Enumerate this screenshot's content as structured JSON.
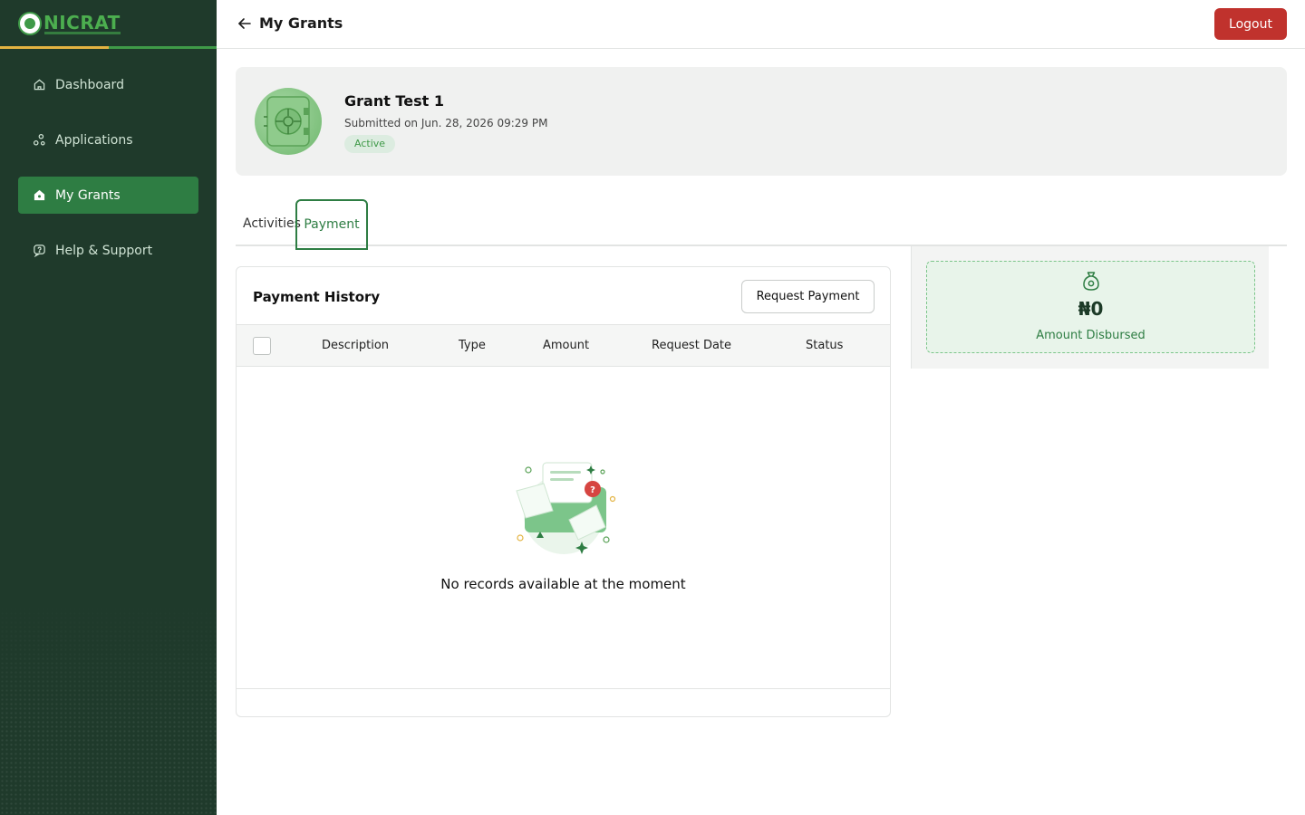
{
  "brand": {
    "name": "NICRAT",
    "accent": "#2e7d43",
    "sidebar_bg": "#1f3a2b",
    "danger": "#c0322d"
  },
  "sidebar": {
    "items": [
      {
        "label": "Dashboard",
        "icon": "home-icon",
        "active": false
      },
      {
        "label": "Applications",
        "icon": "nodes-icon",
        "active": false
      },
      {
        "label": "My Grants",
        "icon": "grant-icon",
        "active": true
      },
      {
        "label": "Help & Support",
        "icon": "help-icon",
        "active": false
      }
    ]
  },
  "header": {
    "title": "My Grants",
    "logout_label": "Logout"
  },
  "grant": {
    "title": "Grant Test 1",
    "submitted": "Submitted on Jun. 28, 2026 09:29 PM",
    "status": "Active"
  },
  "tabs": [
    {
      "label": "Activities",
      "active": false
    },
    {
      "label": "Payment",
      "active": true
    }
  ],
  "payment_history": {
    "title": "Payment History",
    "request_label": "Request Payment",
    "columns": [
      "Description",
      "Type",
      "Amount",
      "Request Date",
      "Status"
    ],
    "rows": [],
    "empty_message": "No records available at the moment"
  },
  "disbursed": {
    "amount": "₦0",
    "label": "Amount Disbursed"
  }
}
